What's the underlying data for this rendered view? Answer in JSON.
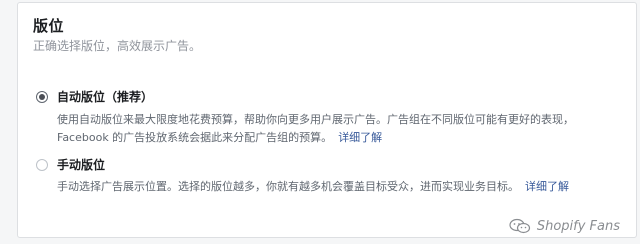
{
  "section": {
    "title": "版位",
    "subtitle": "正确选择版位，高效展示广告。"
  },
  "options": [
    {
      "label": "自动版位（推荐）",
      "checked": true,
      "description": "使用自动版位来最大限度地花费预算，帮助你向更多用户展示广告。广告组在不同版位可能有更好的表现，Facebook 的广告投放系统会据此来分配广告组的预算。",
      "link": "详细了解"
    },
    {
      "label": "手动版位",
      "checked": false,
      "description": "手动选择广告展示位置。选择的版位越多，你就有越多机会覆盖目标受众，进而实现业务目标。",
      "link": "详细了解"
    }
  ],
  "watermark": {
    "text": "Shopify Fans",
    "icon": "wechat-icon"
  }
}
